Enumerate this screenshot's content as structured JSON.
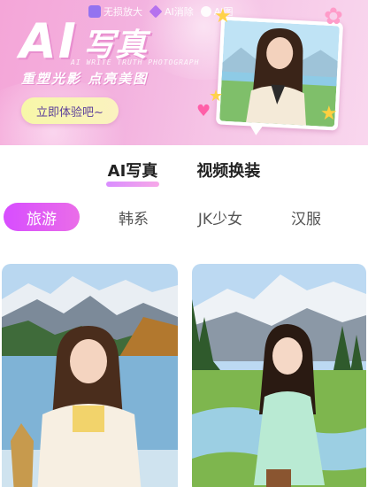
{
  "banner": {
    "tools": [
      {
        "icon": "enlarge-icon",
        "label": "无损放大"
      },
      {
        "icon": "eraser-icon",
        "label": "AI消除"
      },
      {
        "icon": "puzzle-icon",
        "label": "AI图"
      }
    ],
    "title_ai": "AI",
    "title_cn": "写真",
    "english_text": "AI WRITE TRUTH PHOTOGRAPH",
    "subtitle": "重塑光影  点亮美图",
    "cta_label": "立即体验吧~"
  },
  "main_tabs": [
    {
      "label": "AI写真",
      "active": true
    },
    {
      "label": "视频换装",
      "active": false
    }
  ],
  "chips": [
    {
      "label": "旅游",
      "active": true
    },
    {
      "label": "韩系",
      "active": false
    },
    {
      "label": "JK少女",
      "active": false
    },
    {
      "label": "汉服",
      "active": false
    }
  ],
  "colors": {
    "banner_pink": "#f3b2df",
    "chip_active": "#d74dff",
    "cta_yellow": "#f7f7a8",
    "tab_underline": "#d98dff"
  }
}
